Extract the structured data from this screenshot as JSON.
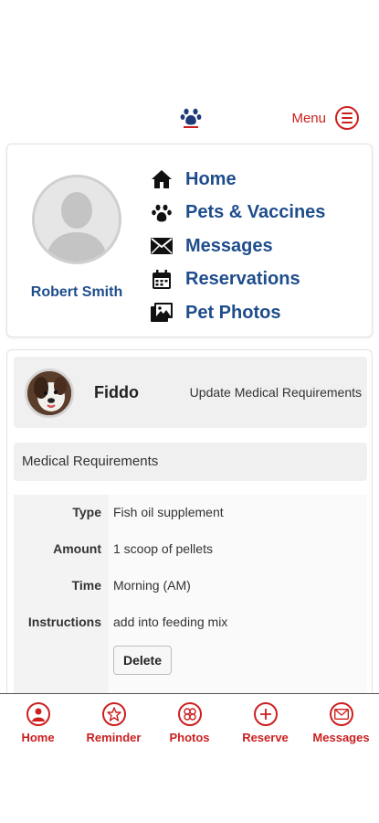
{
  "header": {
    "menu_label": "Menu"
  },
  "profile": {
    "user_name": "Robert Smith"
  },
  "nav": {
    "items": [
      {
        "label": "Home",
        "icon": "home-icon"
      },
      {
        "label": "Pets & Vaccines",
        "icon": "paw-icon"
      },
      {
        "label": "Messages",
        "icon": "envelope-icon"
      },
      {
        "label": "Reservations",
        "icon": "calendar-icon"
      },
      {
        "label": "Pet Photos",
        "icon": "photos-icon"
      }
    ]
  },
  "pet": {
    "name": "Fiddo",
    "update_link": "Update Medical Requirements"
  },
  "medical": {
    "section_title": "Medical Requirements",
    "rows": [
      {
        "label": "Type",
        "value": "Fish oil supplement"
      },
      {
        "label": "Amount",
        "value": "1 scoop of pellets"
      },
      {
        "label": "Time",
        "value": "Morning (AM)"
      },
      {
        "label": "Instructions",
        "value": "add into feeding mix"
      }
    ],
    "delete_label": "Delete"
  },
  "bottom_nav": {
    "tabs": [
      {
        "label": "Home",
        "icon": "person-icon"
      },
      {
        "label": "Reminder",
        "icon": "star-icon"
      },
      {
        "label": "Photos",
        "icon": "camera-icon"
      },
      {
        "label": "Reserve",
        "icon": "plus-icon"
      },
      {
        "label": "Messages",
        "icon": "envelope-icon"
      }
    ]
  },
  "colors": {
    "accent_red": "#cc1f1f",
    "brand_blue": "#1e4d8c"
  }
}
